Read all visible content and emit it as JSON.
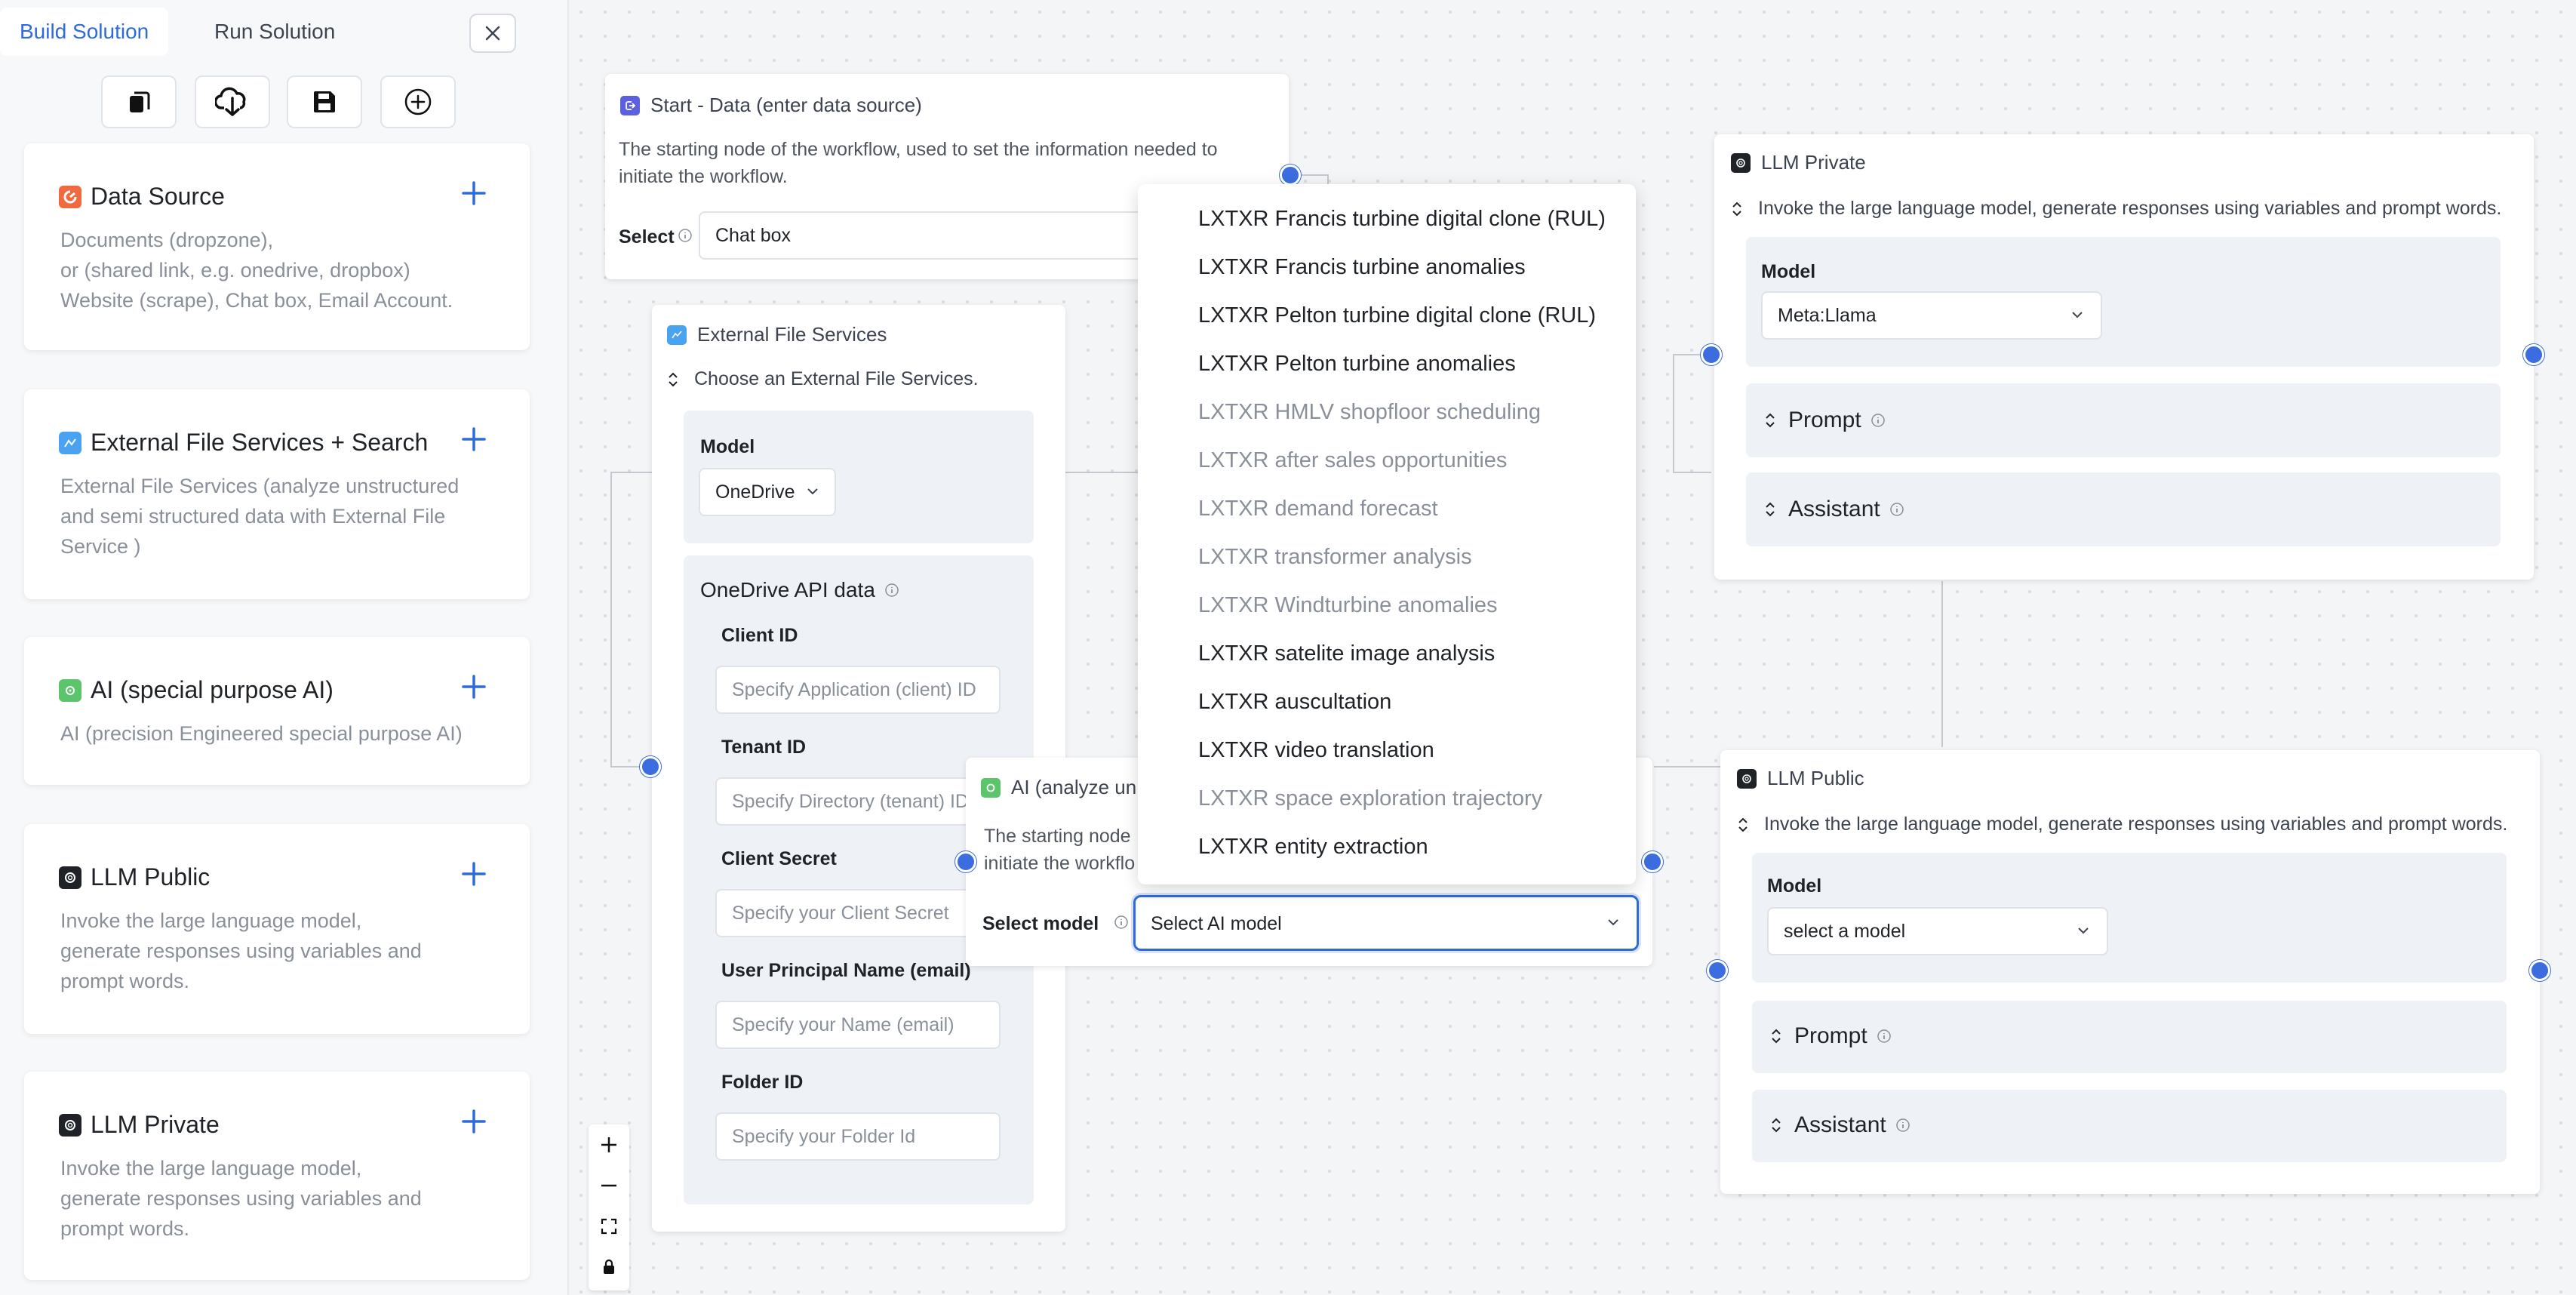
{
  "tabs": {
    "build": "Build Solution",
    "run": "Run Solution"
  },
  "toolbar": {
    "icons": [
      "copy-icon",
      "cloud-download-icon",
      "save-icon",
      "add-circle-icon"
    ]
  },
  "sidebar": {
    "cards": [
      {
        "title": "Data Source",
        "icon_color": "#f06a3f",
        "desc": [
          "Documents (dropzone),",
          "or (shared link, e.g. onedrive, dropbox)",
          "Website (scrape), Chat box, Email Account."
        ]
      },
      {
        "title": "External File Services + Search",
        "icon_color": "#4aa3f0",
        "desc": [
          "External File Services (analyze unstructured",
          "and semi structured data with External File",
          "Service )"
        ]
      },
      {
        "title": "AI (special purpose AI)",
        "icon_color": "#5cc46b",
        "desc": [
          "AI (precision Engineered special purpose AI)"
        ]
      },
      {
        "title": "LLM Public",
        "icon_color": "#1f2328",
        "desc": [
          "Invoke the large language model,",
          "generate responses using variables and",
          "prompt words."
        ]
      },
      {
        "title": "LLM Private",
        "icon_color": "#1f2328",
        "desc": [
          "Invoke the large language model,",
          "generate responses using variables and",
          "prompt words."
        ]
      }
    ]
  },
  "start_node": {
    "title": "Start - Data (enter data source)",
    "desc": [
      "The starting node of the workflow, used to set the information needed to",
      "initiate the workflow."
    ],
    "select_label": "Select",
    "select_value": "Chat box"
  },
  "external_node": {
    "title": "External File Services",
    "subtitle": "Choose an External File Services.",
    "model_label": "Model",
    "model_value": "OneDrive",
    "api_title": "OneDrive API data",
    "fields": [
      {
        "label": "Client ID",
        "placeholder": "Specify Application (client) ID"
      },
      {
        "label": "Tenant ID",
        "placeholder": "Specify Directory (tenant) ID"
      },
      {
        "label": "Client Secret",
        "placeholder": "Specify your Client Secret"
      },
      {
        "label": "User Principal Name (email)",
        "placeholder": "Specify your Name (email)"
      },
      {
        "label": "Folder ID",
        "placeholder": "Specify your Folder Id"
      }
    ]
  },
  "ai_node": {
    "title": "AI (analyze un",
    "desc": [
      "The starting node",
      "initiate the workflo"
    ],
    "select_label": "Select model",
    "select_value": "Select AI model"
  },
  "dropdown": {
    "items": [
      {
        "label": "LXTXR Francis turbine digital clone (RUL)",
        "enabled": true
      },
      {
        "label": "LXTXR Francis turbine anomalies",
        "enabled": true
      },
      {
        "label": "LXTXR Pelton turbine digital clone (RUL)",
        "enabled": true
      },
      {
        "label": "LXTXR Pelton turbine anomalies",
        "enabled": true
      },
      {
        "label": "LXTXR HMLV shopfloor scheduling",
        "enabled": false
      },
      {
        "label": "LXTXR after sales opportunities",
        "enabled": false
      },
      {
        "label": "LXTXR demand forecast",
        "enabled": false
      },
      {
        "label": "LXTXR transformer analysis",
        "enabled": false
      },
      {
        "label": "LXTXR Windturbine anomalies",
        "enabled": false
      },
      {
        "label": "LXTXR satelite image analysis",
        "enabled": true
      },
      {
        "label": "LXTXR auscultation",
        "enabled": true
      },
      {
        "label": "LXTXR video translation",
        "enabled": true
      },
      {
        "label": "LXTXR space exploration trajectory",
        "enabled": false
      },
      {
        "label": "LXTXR entity extraction",
        "enabled": true
      }
    ]
  },
  "llm_private_node": {
    "title": "LLM Private",
    "subtitle": "Invoke the large language model, generate responses using variables and prompt words.",
    "model_label": "Model",
    "model_value": "Meta:Llama",
    "prompt_label": "Prompt",
    "assistant_label": "Assistant"
  },
  "llm_public_node": {
    "title": "LLM Public",
    "subtitle": "Invoke the large language model, generate responses using variables and prompt words.",
    "model_label": "Model",
    "model_value": "select a model",
    "prompt_label": "Prompt",
    "assistant_label": "Assistant"
  },
  "colors": {
    "accent": "#2e6bd8",
    "handle": "#3b6de0",
    "panel": "#eef1f6"
  }
}
